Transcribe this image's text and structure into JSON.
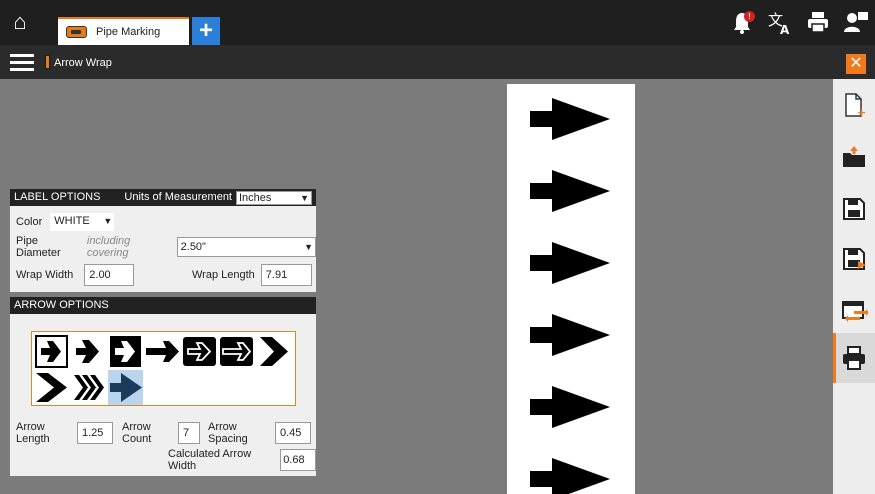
{
  "topbar": {
    "home_icon": "home-icon",
    "tab": {
      "label": "Pipe Marking",
      "icon": "pipe-marker-icon"
    },
    "add_tab_label": "+",
    "icons": [
      "notification-bell-icon",
      "translate-icon",
      "printer-icon",
      "account-icon"
    ],
    "bell_badge": "!"
  },
  "subbar": {
    "template_name": "Arrow Wrap",
    "close_label": "✕"
  },
  "label_options": {
    "header": "LABEL OPTIONS",
    "units_label": "Units of Measurement",
    "units_value": "Inches",
    "color_label": "Color",
    "color_value": "WHITE",
    "pipe_diameter_label": "Pipe Diameter",
    "pipe_diameter_hint": "including covering",
    "pipe_diameter_value": "2.50\"",
    "wrap_width_label": "Wrap Width",
    "wrap_width_value": "2.00",
    "wrap_length_label": "Wrap Length",
    "wrap_length_value": "7.91"
  },
  "arrow_options": {
    "header": "ARROW OPTIONS",
    "styles": [
      "arrow-outline-box",
      "arrow-bold",
      "arrow-chevron-box",
      "arrow-long",
      "arrow-outline-black-box",
      "arrow-long-black-box",
      "chevron-bold",
      "chevron-wide",
      "chevron-triple",
      "arrow-solid-selected"
    ],
    "arrow_length_label": "Arrow Length",
    "arrow_length_value": "1.25",
    "arrow_count_label": "Arrow Count",
    "arrow_count_value": "7",
    "arrow_spacing_label": "Arrow Spacing",
    "arrow_spacing_value": "0.45",
    "calc_width_label": "Calculated Arrow Width",
    "calc_width_value": "0.68"
  },
  "right_rail": {
    "icons": [
      "new-file-icon",
      "open-folder-icon",
      "save-icon",
      "save-as-icon",
      "import-export-icon",
      "print-icon"
    ]
  },
  "colors": {
    "accent": "#f07b1f",
    "topbar": "#1f1f1f",
    "canvas": "#7b7b7b",
    "tab_add": "#2c7fd6"
  }
}
